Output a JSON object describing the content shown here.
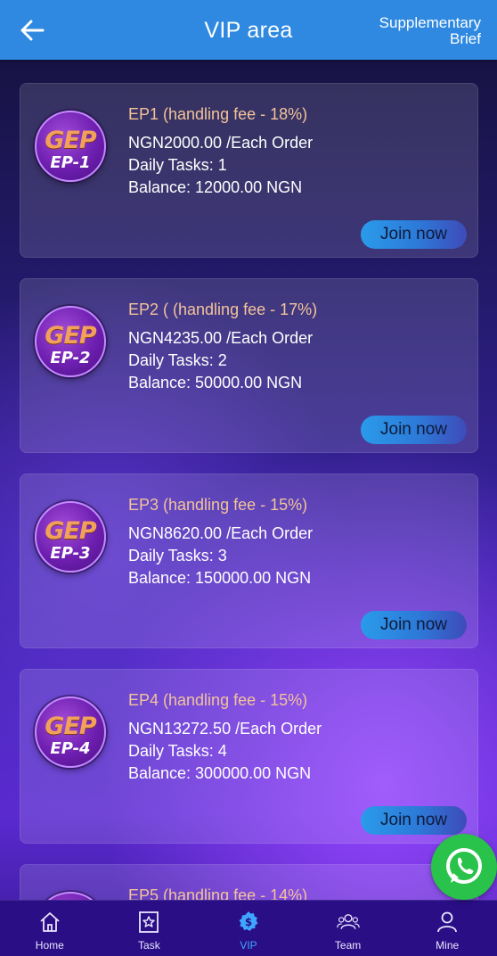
{
  "header": {
    "title": "VIP area",
    "right_link": "Supplementary Brief"
  },
  "badge_logo": "GEP",
  "cards": [
    {
      "title": "EP1 (handling fee - 18%)",
      "badge_level": "EP-1",
      "price": "NGN2000.00 /Each Order",
      "daily_tasks": "Daily Tasks: 1",
      "balance": "Balance: 12000.00 NGN",
      "button": "Join now"
    },
    {
      "title": "EP2 ( (handling fee - 17%)",
      "badge_level": "EP-2",
      "price": "NGN4235.00 /Each Order",
      "daily_tasks": "Daily Tasks: 2",
      "balance": "Balance: 50000.00 NGN",
      "button": "Join now"
    },
    {
      "title": "EP3 (handling fee - 15%)",
      "badge_level": "EP-3",
      "price": "NGN8620.00 /Each Order",
      "daily_tasks": "Daily Tasks: 3",
      "balance": "Balance: 150000.00 NGN",
      "button": "Join now"
    },
    {
      "title": "EP4 (handling fee - 15%)",
      "badge_level": "EP-4",
      "price": "NGN13272.50 /Each Order",
      "daily_tasks": "Daily Tasks: 4",
      "balance": "Balance: 300000.00 NGN",
      "button": "Join now"
    },
    {
      "title": "EP5 (handling fee - 14%)"
    }
  ],
  "tabbar": {
    "active": "VIP",
    "items": [
      {
        "label": "Home",
        "icon": "home-icon"
      },
      {
        "label": "Task",
        "icon": "task-icon"
      },
      {
        "label": "VIP",
        "icon": "vip-icon"
      },
      {
        "label": "Team",
        "icon": "team-icon"
      },
      {
        "label": "Mine",
        "icon": "user-icon"
      }
    ]
  },
  "colors": {
    "header": "#2f89e0",
    "tabbar": "#2a0e86",
    "active_tab": "#3ea6ff",
    "card_title": "#f3c39a",
    "whatsapp": "#29c24a"
  }
}
